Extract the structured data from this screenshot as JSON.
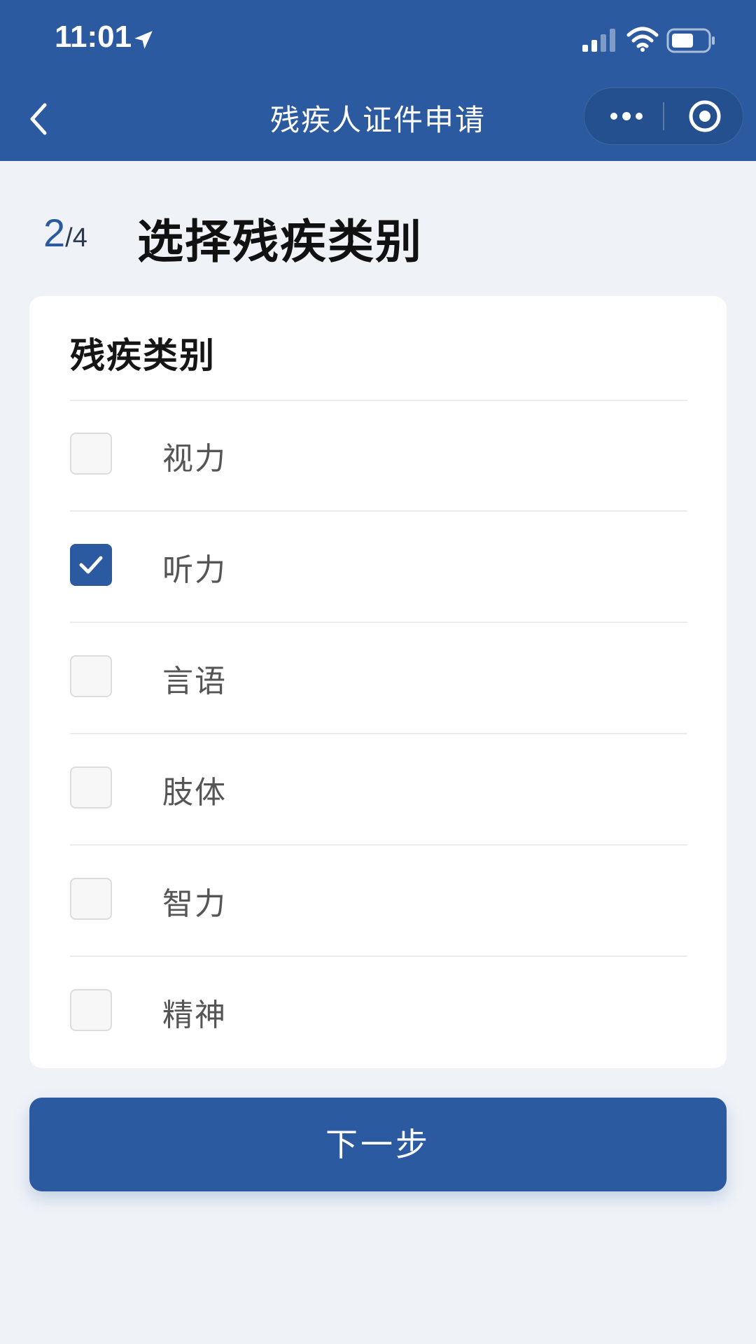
{
  "status_bar": {
    "time": "11:01",
    "icons": [
      "location-arrow-icon",
      "signal-icon",
      "wifi-icon",
      "battery-icon"
    ]
  },
  "nav": {
    "title": "残疾人证件申请",
    "icons": [
      "back-icon",
      "more-icon",
      "close-icon"
    ]
  },
  "step": {
    "current": "2",
    "total": "/4"
  },
  "page_title": "选择残疾类别",
  "card": {
    "title": "残疾类别",
    "options": [
      {
        "label": "视力",
        "checked": false
      },
      {
        "label": "听力",
        "checked": true
      },
      {
        "label": "言语",
        "checked": false
      },
      {
        "label": "肢体",
        "checked": false
      },
      {
        "label": "智力",
        "checked": false
      },
      {
        "label": "精神",
        "checked": false
      }
    ]
  },
  "next_button": {
    "label": "下一步"
  },
  "colors": {
    "primary": "#2b5aa0",
    "background": "#eff2f7",
    "card": "#ffffff",
    "text": "#111111"
  }
}
